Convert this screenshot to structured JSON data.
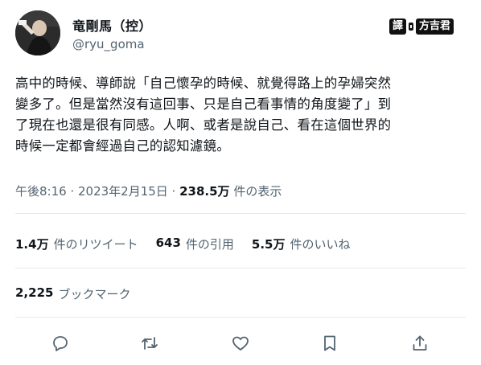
{
  "author": {
    "display_name": "竜剛馬（控）",
    "handle": "@ryu_goma",
    "avatar_icon": "avatar-photo-icon"
  },
  "watermark": {
    "left_label": "譯",
    "right_label": "方吉君"
  },
  "tweet": {
    "lines": [
      "高中的時候、導師說「自己懷孕的時候、就覺得路上的孕婦突然",
      "變多了。但是當然沒有這回事、只是自己看事情的角度變了」到",
      "了現在也還是很有同感。人啊、或者是說自己、看在這個世界的",
      "時候一定都會經過自己的認知濾鏡。"
    ]
  },
  "meta": {
    "timestamp": "午後8:16 · 2023年2月15日 · ",
    "views_count": "238.5万",
    "views_label": " 件の表示"
  },
  "stats": {
    "retweets": {
      "count": "1.4万",
      "label": "件のリツイート"
    },
    "quotes": {
      "count": "643",
      "label": "件の引用"
    },
    "likes": {
      "count": "5.5万",
      "label": "件のいいね"
    },
    "bookmarks": {
      "count": "2,225",
      "label": "ブックマーク"
    }
  },
  "actions": {
    "reply_icon": "reply-icon",
    "retweet_icon": "retweet-icon",
    "like_icon": "heart-icon",
    "bookmark_icon": "bookmark-icon",
    "share_icon": "share-icon"
  },
  "colors": {
    "text_primary": "#0f1419",
    "text_secondary": "#536471",
    "divider": "#e6e9eb",
    "icon": "#536471"
  }
}
